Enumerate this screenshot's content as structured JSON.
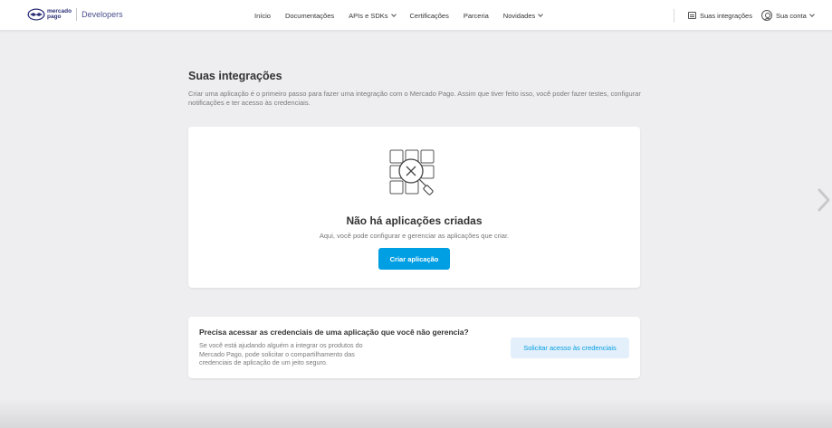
{
  "brand": {
    "logo_line1": "mercado",
    "logo_line2": "pago",
    "product": "Developers",
    "accent": "#009ee3",
    "logo_color": "#2d3277"
  },
  "nav": {
    "items": [
      {
        "label": "Início",
        "dropdown": false
      },
      {
        "label": "Documentações",
        "dropdown": false
      },
      {
        "label": "APIs e SDKs",
        "dropdown": true
      },
      {
        "label": "Certificações",
        "dropdown": false
      },
      {
        "label": "Parceria",
        "dropdown": false
      },
      {
        "label": "Novidades",
        "dropdown": true
      }
    ],
    "integrations_label": "Suas integrações",
    "integrations_icon": "integrations-icon",
    "account_label": "Sua conta",
    "account_icon": "user-icon"
  },
  "main": {
    "title": "Suas integrações",
    "intro": "Criar uma aplicação é o primeiro passo para fazer uma integração com o Mercado Pago. Assim que tiver feito isso, você poder fazer testes, configurar notificações e ter acesso às credenciais."
  },
  "empty_state": {
    "icon": "no-apps-magnifier-icon",
    "title": "Não há aplicações criadas",
    "subtitle": "Aqui, você pode configurar e gerenciar as aplicações que criar.",
    "button_label": "Criar aplicação"
  },
  "access": {
    "title": "Precisa acessar as credenciais de uma aplicação que você não gerencia?",
    "text": "Se você está ajudando alguém a integrar os produtos do Mercado Pago, pode solicitar o compartilhamento das credenciais de aplicação de um jeito seguro.",
    "button_label": "Solicitar acesso às credenciais"
  }
}
